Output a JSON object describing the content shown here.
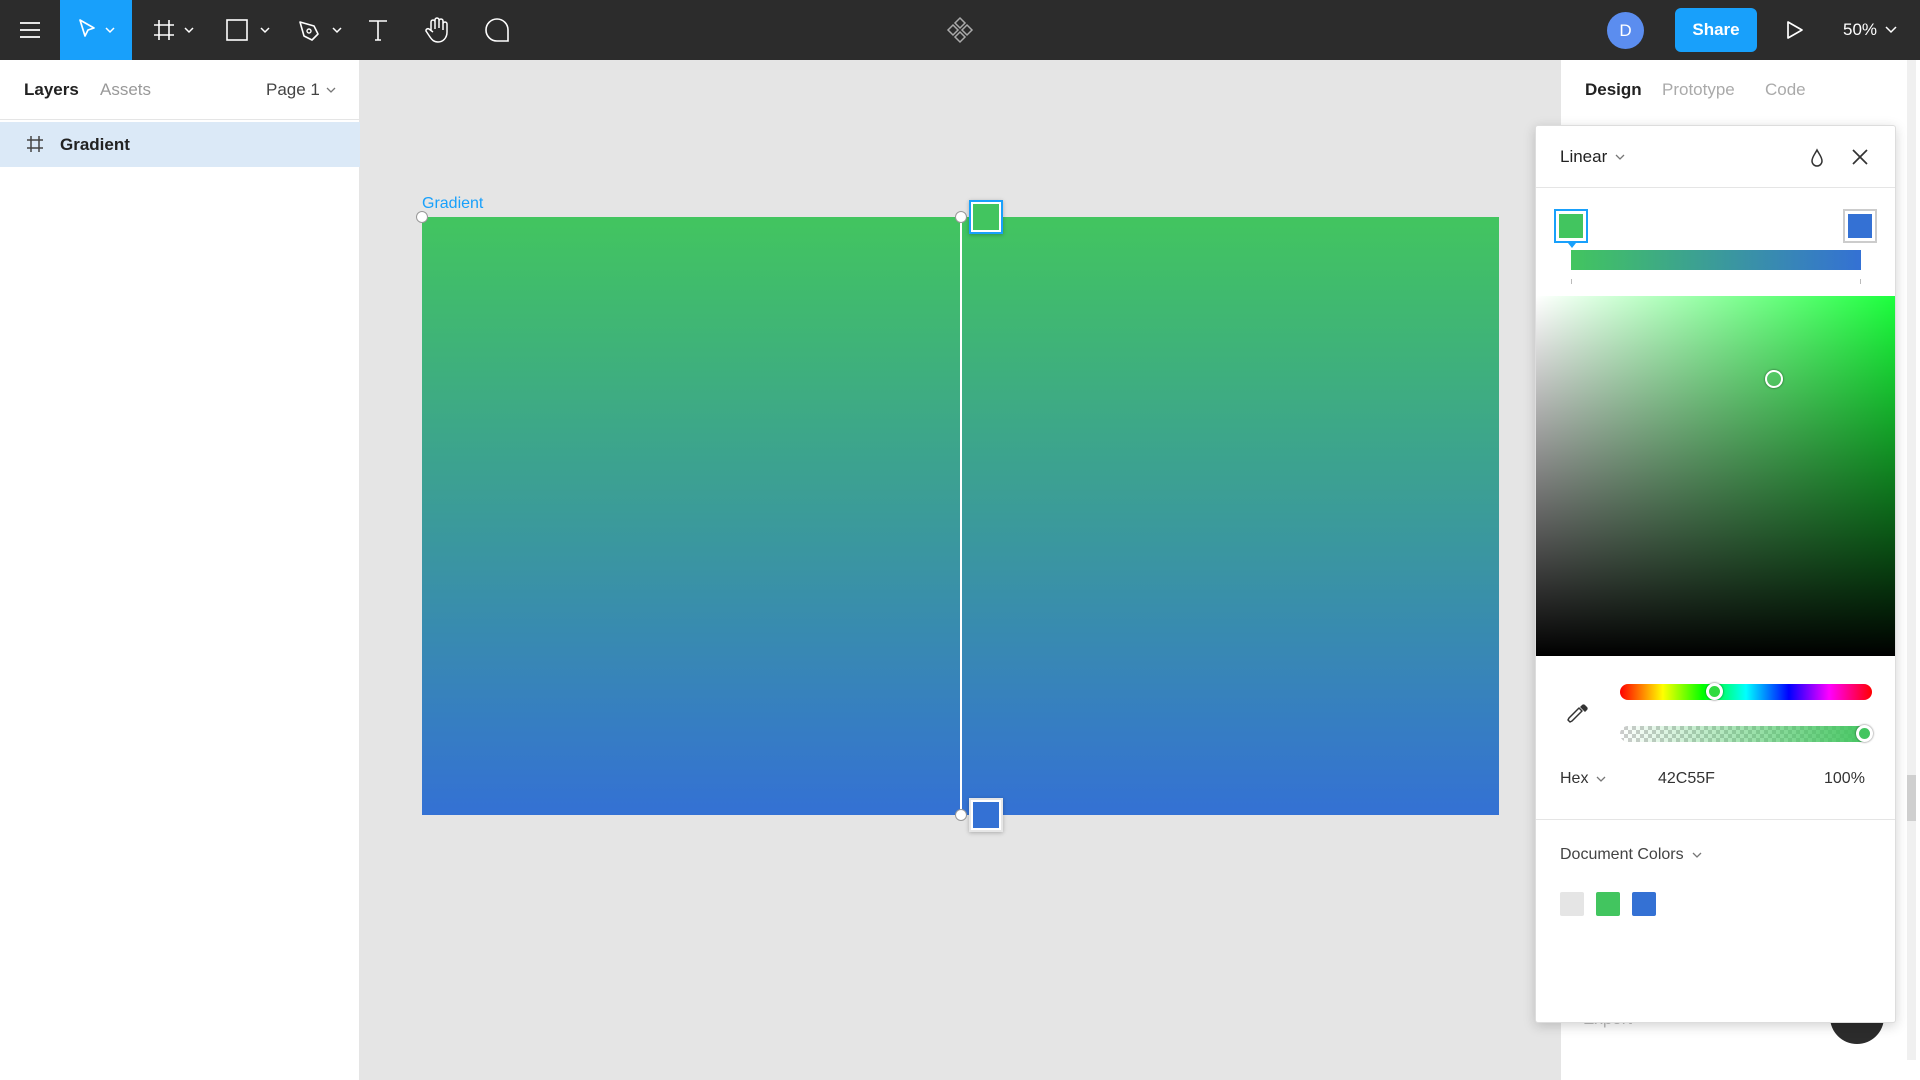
{
  "toolbar": {
    "menu_icon": "hamburger-menu-icon",
    "move_tool": "move-tool-icon",
    "frame_tool": "frame-tool-icon",
    "shape_tool": "rectangle-tool-icon",
    "pen_tool": "pen-tool-icon",
    "text_tool": "text-tool-icon",
    "hand_tool": "hand-tool-icon",
    "comment_tool": "comment-tool-icon",
    "component_icon": "component-icon",
    "avatar_initial": "D",
    "share_label": "Share",
    "play_icon": "present-play-icon",
    "zoom_label": "50%",
    "accent_color": "#18a0fb"
  },
  "left_panel": {
    "tabs": [
      {
        "label": "Layers",
        "active": true
      },
      {
        "label": "Assets",
        "active": false
      }
    ],
    "page_selector": "Page 1",
    "layers": [
      {
        "name": "Gradient",
        "icon": "frame-hash-icon",
        "selected": true
      }
    ]
  },
  "canvas": {
    "frame_label": "Gradient",
    "gradient_start": "#42c55f",
    "gradient_end": "#3471d4",
    "background": "#e5e5e5"
  },
  "right_panel": {
    "tabs": [
      {
        "label": "Design",
        "active": true
      },
      {
        "label": "Prototype",
        "active": false
      },
      {
        "label": "Code",
        "active": false
      }
    ],
    "export_label": "Export"
  },
  "color_picker": {
    "fill_type": "Linear",
    "blend_icon": "drop-icon",
    "close_icon": "close-icon",
    "stops": [
      {
        "color": "#42c55f",
        "selected": true
      },
      {
        "color": "#3471d4",
        "selected": false
      }
    ],
    "eyedropper_icon": "eyedropper-icon",
    "format": "Hex",
    "hex_value": "42C55F",
    "opacity": "100%",
    "document_colors_label": "Document Colors",
    "document_colors": [
      "#e5e5e5",
      "#42c55f",
      "#3471d4"
    ]
  }
}
